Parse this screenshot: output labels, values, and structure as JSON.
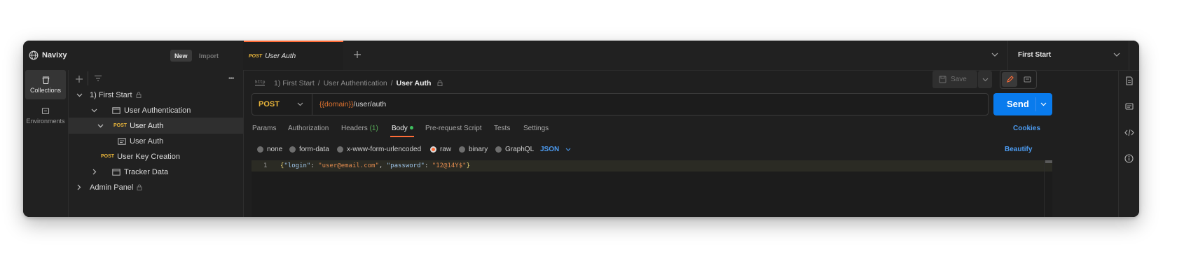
{
  "workspace": {
    "name": "Navixy",
    "new_label": "New",
    "import_label": "Import"
  },
  "rail": [
    {
      "label": "Collections",
      "icon": "collections-icon"
    },
    {
      "label": "Environments",
      "icon": "environments-icon"
    }
  ],
  "tree": [
    {
      "label": "1) First Start",
      "type": "collection"
    },
    {
      "label": "User Authentication",
      "type": "folder"
    },
    {
      "label": "User Auth",
      "method": "POST",
      "type": "request"
    },
    {
      "label": "User Auth",
      "type": "example"
    },
    {
      "label": "User Key Creation",
      "method": "POST",
      "type": "request"
    },
    {
      "label": "Tracker Data",
      "type": "folder"
    },
    {
      "label": "Admin Panel",
      "type": "collection"
    }
  ],
  "tab": {
    "method": "POST",
    "label": "User Auth"
  },
  "environment": {
    "label": "First Start"
  },
  "breadcrumb": {
    "part1": "1) First Start",
    "sep": "/",
    "part2": "User Authentication",
    "current": "User Auth"
  },
  "save_label": "Save",
  "request": {
    "method": "POST",
    "url_var": "{{domain}}",
    "url_path": "/user/auth",
    "send_label": "Send"
  },
  "req_tabs": {
    "params": "Params",
    "authorization": "Authorization",
    "headers": "Headers",
    "headers_count": "(1)",
    "body": "Body",
    "prerequest": "Pre-request Script",
    "tests": "Tests",
    "settings": "Settings",
    "cookies": "Cookies"
  },
  "body_modes": {
    "none": "none",
    "form_data": "form-data",
    "urlencoded": "x-www-form-urlencoded",
    "raw": "raw",
    "binary": "binary",
    "graphql": "GraphQL",
    "format": "JSON",
    "beautify": "Beautify",
    "selected": "raw"
  },
  "editor": {
    "line_number": "1",
    "t1": "{",
    "k1": "\"login\"",
    "t2": ": ",
    "v1": "\"user@email.com\"",
    "t3": ", ",
    "k2": "\"password\"",
    "t4": ": ",
    "v2": "\"12@14Y$\"",
    "t5": "}"
  },
  "colors": {
    "accent": "#ff6c37",
    "send": "#097bed",
    "post": "#e9b53a",
    "link": "#4c9bf0",
    "string": "#e08a4e",
    "key": "#9fc6ea"
  }
}
